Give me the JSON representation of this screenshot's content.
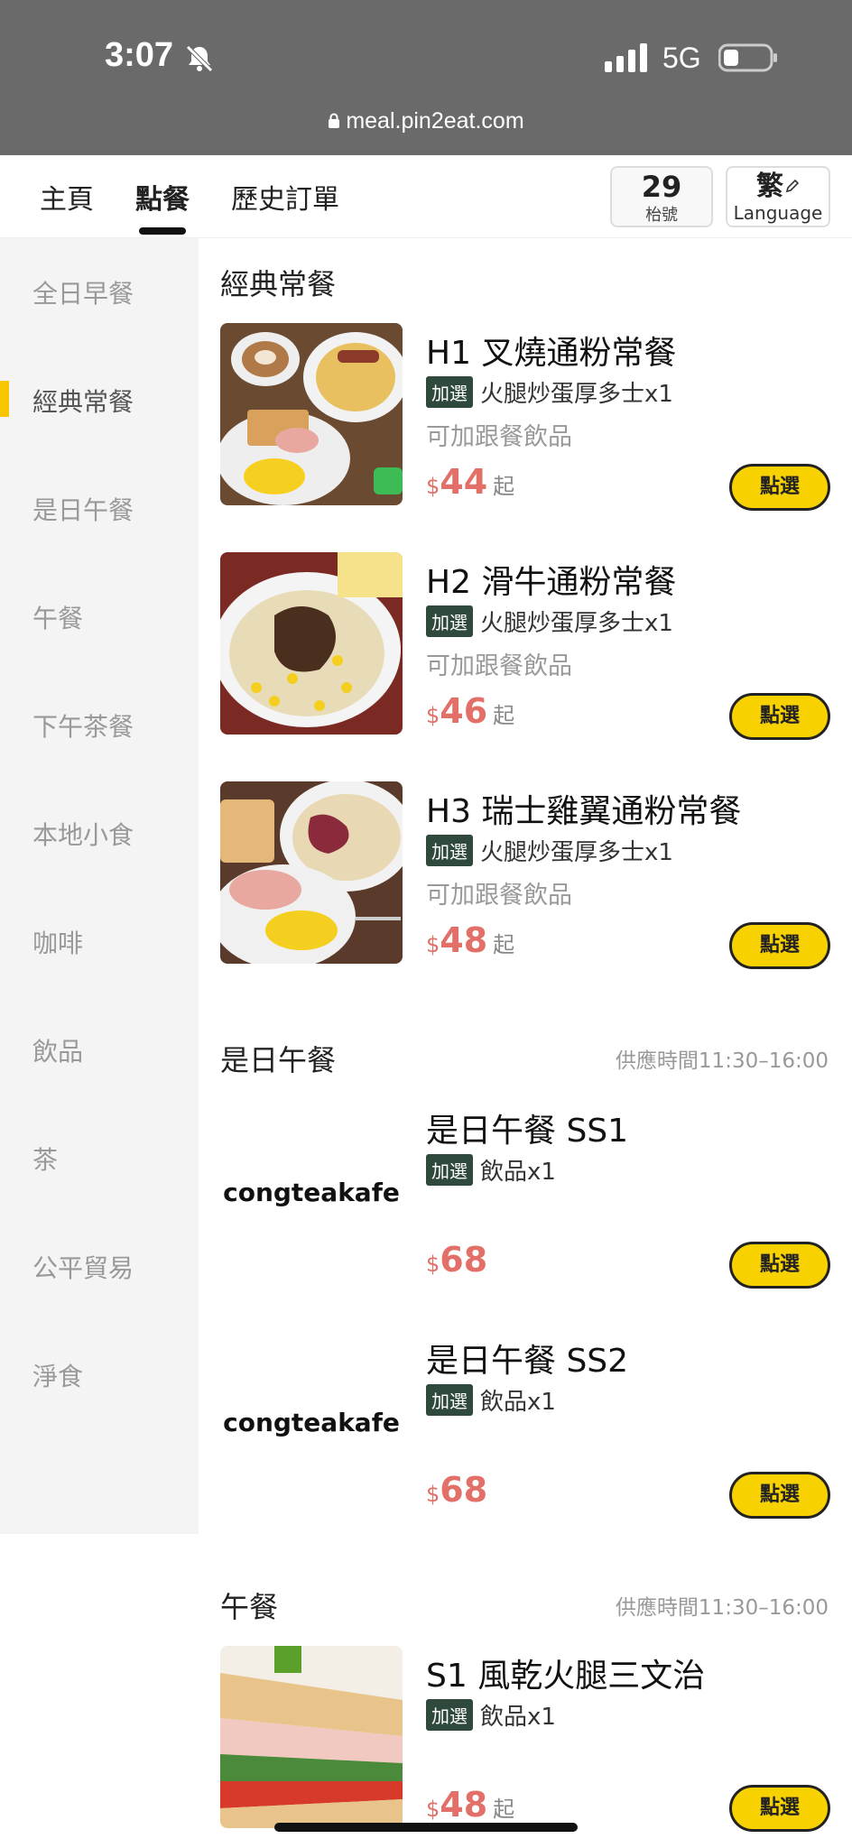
{
  "status": {
    "time": "3:07",
    "network": "5G",
    "url": "meal.pin2eat.com"
  },
  "nav": {
    "tabs": [
      "主頁",
      "點餐",
      "歷史訂單"
    ],
    "table_number": "29",
    "table_label": "枱號",
    "lang_char": "繁",
    "lang_label": "Language"
  },
  "sidebar": [
    "全日早餐",
    "經典常餐",
    "是日午餐",
    "午餐",
    "下午茶餐",
    "本地小食",
    "咖啡",
    "飲品",
    "茶",
    "公平貿易",
    "淨食"
  ],
  "sections": [
    {
      "title": "經典常餐",
      "items": [
        {
          "name": "H1 叉燒通粉常餐",
          "addon_tag": "加選",
          "addon": "火腿炒蛋厚多士x1",
          "note": "可加跟餐飲品",
          "currency": "$",
          "price": "44",
          "from": "起",
          "button": "點選"
        },
        {
          "name": "H2 滑牛通粉常餐",
          "addon_tag": "加選",
          "addon": "火腿炒蛋厚多士x1",
          "note": "可加跟餐飲品",
          "currency": "$",
          "price": "46",
          "from": "起",
          "button": "點選"
        },
        {
          "name": "H3 瑞士雞翼通粉常餐",
          "addon_tag": "加選",
          "addon": "火腿炒蛋厚多士x1",
          "note": "可加跟餐飲品",
          "currency": "$",
          "price": "48",
          "from": "起",
          "button": "點選"
        }
      ]
    },
    {
      "title": "是日午餐",
      "hours": "供應時間11:30–16:00",
      "items": [
        {
          "name": "是日午餐 SS1",
          "addon_tag": "加選",
          "addon": "飲品x1",
          "logo": "congteakafe",
          "currency": "$",
          "price": "68",
          "button": "點選"
        },
        {
          "name": "是日午餐 SS2",
          "addon_tag": "加選",
          "addon": "飲品x1",
          "logo": "congteakafe",
          "currency": "$",
          "price": "68",
          "button": "點選"
        }
      ]
    },
    {
      "title": "午餐",
      "hours": "供應時間11:30–16:00",
      "items": [
        {
          "name": "S1 風乾火腿三文治",
          "addon_tag": "加選",
          "addon": "飲品x1",
          "currency": "$",
          "price": "48",
          "from": "起",
          "button": "點選"
        }
      ]
    }
  ],
  "colors": {
    "accent": "#f7d100",
    "price": "#e27068",
    "tag": "#2f4a3c",
    "sidebar_indicator": "#f7c600"
  }
}
